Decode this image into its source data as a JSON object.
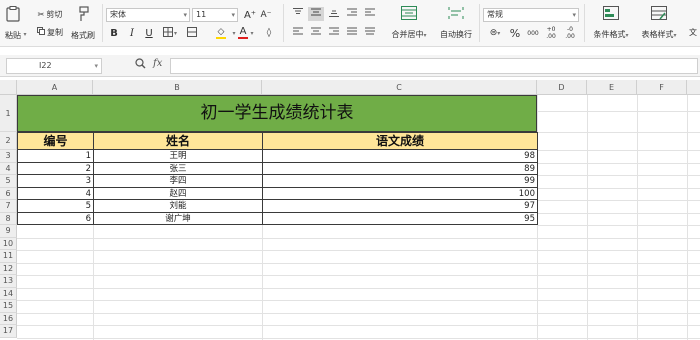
{
  "ribbon": {
    "paste": "粘贴",
    "cut": "剪切",
    "copy": "复制",
    "format_painter": "格式刷",
    "font_name": "宋体",
    "font_size": "11",
    "grow_font": "A⁺",
    "shrink_font": "A⁻",
    "bold": "B",
    "italic": "I",
    "underline": "U",
    "font_color_letter": "A",
    "merge_center": "合并居中",
    "wrap_text": "自动换行",
    "number_format": "常规",
    "percent": "%",
    "thousands": "000",
    "inc_decimal": "+0\n.00",
    "dec_decimal": "-0\n.00",
    "conditional_format": "条件格式",
    "table_style": "表格样式",
    "text_partial": "文",
    "colors": {
      "font_red": "#e02020",
      "fill_yellow": "#ffd700",
      "accent_green": "#2e8b57"
    }
  },
  "formula_bar": {
    "name_box": "I22",
    "fx": "fx",
    "formula": ""
  },
  "sheet": {
    "columns": [
      "A",
      "B",
      "C",
      "D",
      "E",
      "F"
    ],
    "rows": [
      "1",
      "2",
      "3",
      "4",
      "5",
      "6",
      "7",
      "8",
      "9",
      "10",
      "11",
      "12",
      "13",
      "14",
      "15",
      "16",
      "17"
    ],
    "title": "初一学生成绩统计表",
    "headers": [
      "编号",
      "姓名",
      "语文成绩"
    ],
    "data": [
      [
        "1",
        "王明",
        "98"
      ],
      [
        "2",
        "张三",
        "89"
      ],
      [
        "3",
        "李四",
        "99"
      ],
      [
        "4",
        "赵四",
        "100"
      ],
      [
        "5",
        "刘能",
        "97"
      ],
      [
        "6",
        "谢广坤",
        "95"
      ]
    ],
    "colors": {
      "title_fill": "#70ad47",
      "header_fill": "#ffe699"
    }
  }
}
